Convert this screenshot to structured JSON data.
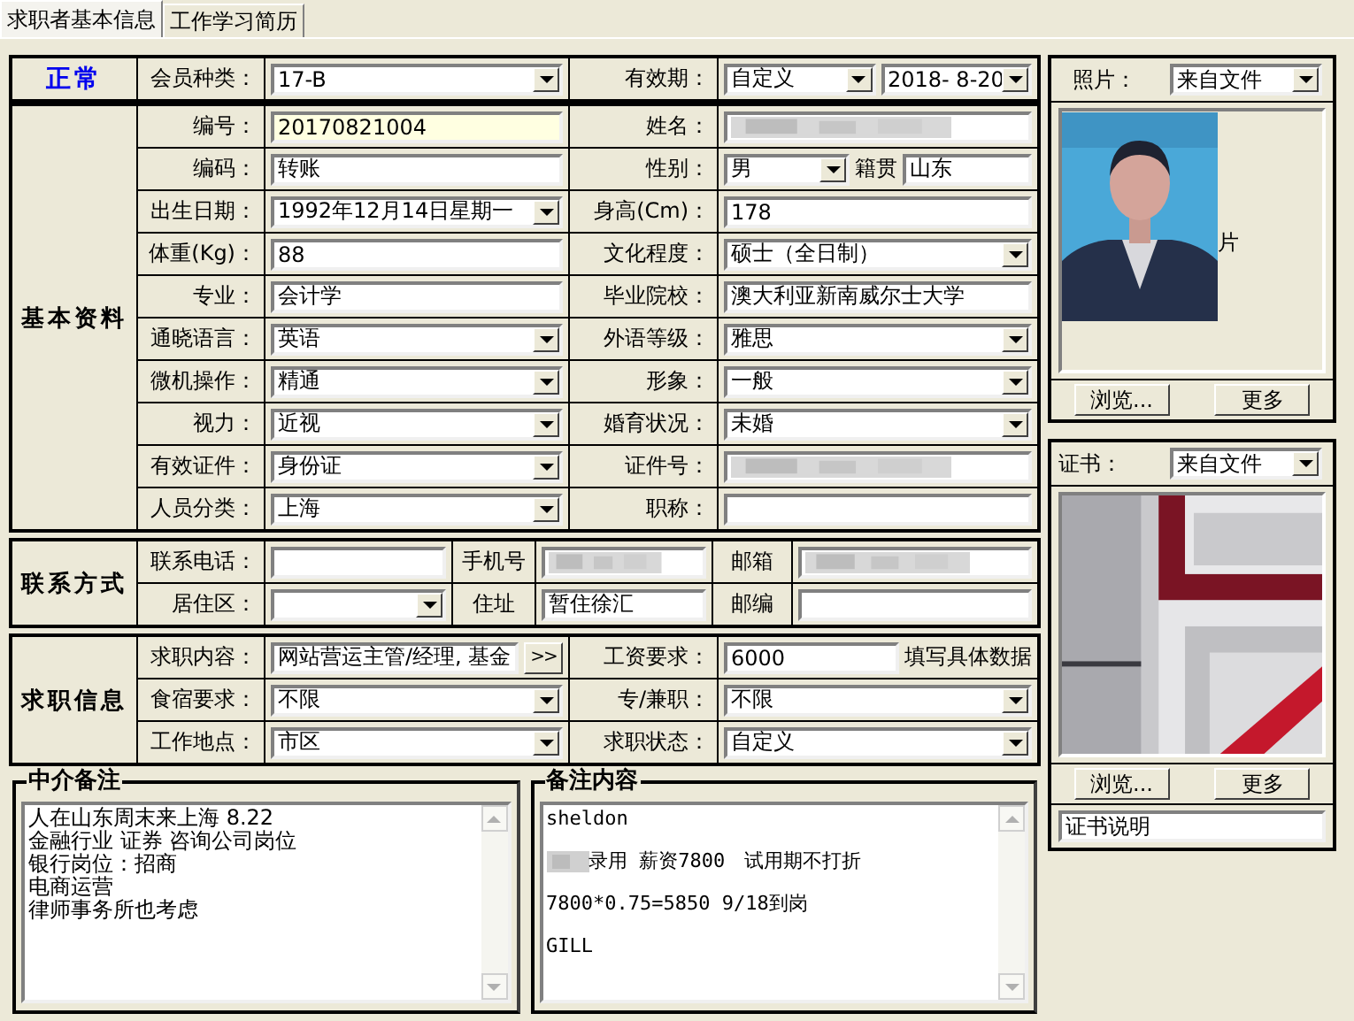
{
  "tabs": [
    {
      "label": "求职者基本信息",
      "selected": true
    },
    {
      "label": "工作学习简历",
      "selected": false
    }
  ],
  "blocks": [
    {
      "kind": "status",
      "title": "正常",
      "rows": [
        {
          "fields": [
            {
              "label": "会员种类：",
              "controls": [
                {
                  "kind": "combo",
                  "value": "17-B"
                }
              ]
            },
            {
              "label": "有效期：",
              "controls": [
                {
                  "kind": "combo",
                  "value": "自定义"
                },
                {
                  "kind": "combo",
                  "value": "2018- 8-20"
                }
              ]
            }
          ]
        }
      ]
    },
    {
      "kind": "group",
      "title": "基本资料",
      "rows": [
        {
          "fields": [
            {
              "label": "编号：",
              "controls": [
                {
                  "kind": "text",
                  "value": "20170821004",
                  "highlighted": true
                }
              ]
            },
            {
              "label": "姓名：",
              "controls": [
                {
                  "kind": "redacted"
                }
              ]
            }
          ]
        },
        {
          "fields": [
            {
              "label": "编码：",
              "controls": [
                {
                  "kind": "text",
                  "value": "转账"
                }
              ]
            },
            {
              "label": "性别：",
              "controls": [
                {
                  "kind": "combo",
                  "value": "男"
                },
                {
                  "kind": "caption",
                  "value": "籍贯"
                },
                {
                  "kind": "text",
                  "value": "山东"
                }
              ]
            }
          ]
        },
        {
          "fields": [
            {
              "label": "出生日期：",
              "controls": [
                {
                  "kind": "combo",
                  "value": "1992年12月14日星期一"
                }
              ]
            },
            {
              "label": "身高(Cm)：",
              "controls": [
                {
                  "kind": "text",
                  "value": "178"
                }
              ]
            }
          ]
        },
        {
          "fields": [
            {
              "label": "体重(Kg)：",
              "controls": [
                {
                  "kind": "text",
                  "value": "88"
                }
              ]
            },
            {
              "label": "文化程度：",
              "controls": [
                {
                  "kind": "combo",
                  "value": "硕士（全日制）"
                }
              ]
            }
          ]
        },
        {
          "fields": [
            {
              "label": "专业：",
              "controls": [
                {
                  "kind": "text",
                  "value": "会计学"
                }
              ]
            },
            {
              "label": "毕业院校：",
              "controls": [
                {
                  "kind": "text",
                  "value": "澳大利亚新南威尔士大学"
                }
              ]
            }
          ]
        },
        {
          "fields": [
            {
              "label": "通晓语言：",
              "controls": [
                {
                  "kind": "combo",
                  "value": "英语"
                }
              ]
            },
            {
              "label": "外语等级：",
              "controls": [
                {
                  "kind": "combo",
                  "value": "雅思"
                }
              ]
            }
          ]
        },
        {
          "fields": [
            {
              "label": "微机操作：",
              "controls": [
                {
                  "kind": "combo",
                  "value": "精通"
                }
              ]
            },
            {
              "label": "形象：",
              "controls": [
                {
                  "kind": "combo",
                  "value": "一般"
                }
              ]
            }
          ]
        },
        {
          "fields": [
            {
              "label": "视力：",
              "controls": [
                {
                  "kind": "combo",
                  "value": "近视"
                }
              ]
            },
            {
              "label": "婚育状况：",
              "controls": [
                {
                  "kind": "combo",
                  "value": "未婚"
                }
              ]
            }
          ]
        },
        {
          "fields": [
            {
              "label": "有效证件：",
              "controls": [
                {
                  "kind": "combo",
                  "value": "身份证"
                }
              ]
            },
            {
              "label": "证件号：",
              "controls": [
                {
                  "kind": "redacted"
                }
              ]
            }
          ]
        },
        {
          "fields": [
            {
              "label": "人员分类：",
              "controls": [
                {
                  "kind": "combo",
                  "value": "上海"
                }
              ]
            },
            {
              "label": "职称：",
              "controls": [
                {
                  "kind": "text"
                }
              ]
            }
          ]
        }
      ]
    },
    {
      "kind": "group",
      "title": "联系方式",
      "rows": [
        {
          "fields": [
            {
              "label": "联系电话：",
              "controls": [
                {
                  "kind": "text"
                }
              ]
            },
            {
              "label": "手机号",
              "controls": [
                {
                  "kind": "redacted"
                }
              ]
            },
            {
              "label": "邮箱",
              "controls": [
                {
                  "kind": "redacted"
                }
              ]
            }
          ]
        },
        {
          "fields": [
            {
              "label": "居住区：",
              "controls": [
                {
                  "kind": "combo"
                }
              ]
            },
            {
              "label": "住址",
              "controls": [
                {
                  "kind": "text",
                  "value": "暂住徐汇"
                }
              ]
            },
            {
              "label": "邮编",
              "controls": [
                {
                  "kind": "text"
                }
              ]
            }
          ]
        }
      ]
    },
    {
      "kind": "group",
      "title": "求职信息",
      "rows": [
        {
          "fields": [
            {
              "label": "求职内容：",
              "controls": [
                {
                  "kind": "text",
                  "value": "网站营运主管/经理, 基金"
                },
                {
                  "kind": "button",
                  "value": ">>"
                }
              ]
            },
            {
              "label": "工资要求：",
              "controls": [
                {
                  "kind": "text",
                  "value": "6000"
                },
                {
                  "kind": "caption",
                  "value": "填写具体数据"
                }
              ]
            }
          ]
        },
        {
          "fields": [
            {
              "label": "食宿要求：",
              "controls": [
                {
                  "kind": "combo",
                  "value": "不限"
                }
              ]
            },
            {
              "label": "专/兼职：",
              "controls": [
                {
                  "kind": "combo",
                  "value": "不限"
                }
              ]
            }
          ]
        },
        {
          "fields": [
            {
              "label": "工作地点：",
              "controls": [
                {
                  "kind": "combo",
                  "value": "市区"
                }
              ]
            },
            {
              "label": "求职状态：",
              "controls": [
                {
                  "kind": "combo",
                  "value": "自定义"
                }
              ]
            }
          ]
        }
      ]
    }
  ],
  "notes": [
    {
      "title": "中介备注",
      "kind": "plain",
      "lines": [
        {
          "text": "人在山东周末来上海 8.22"
        },
        {
          "text": "金融行业 证券 咨询公司岗位"
        },
        {
          "text": "银行岗位：招商"
        },
        {
          "text": "电商运营"
        },
        {
          "text": "律师事务所也考虑"
        }
      ]
    },
    {
      "title": "备注内容",
      "kind": "spaced",
      "lines": [
        {
          "text": "sheldon"
        },
        {
          "text": "录用 薪资7800　试用期不打折",
          "redacted": true
        },
        {
          "text": "7800*0.75=5850  9/18到岗"
        },
        {
          "text": "GILL"
        }
      ]
    }
  ],
  "side": [
    {
      "label": "照片：",
      "source": "来自文件",
      "caption": "片",
      "buttons": [
        "浏览...",
        "更多"
      ]
    },
    {
      "kind": "certificate",
      "label": "证书：",
      "source": "来自文件",
      "buttons": [
        "浏览...",
        "更多"
      ],
      "description": "证书说明"
    }
  ]
}
